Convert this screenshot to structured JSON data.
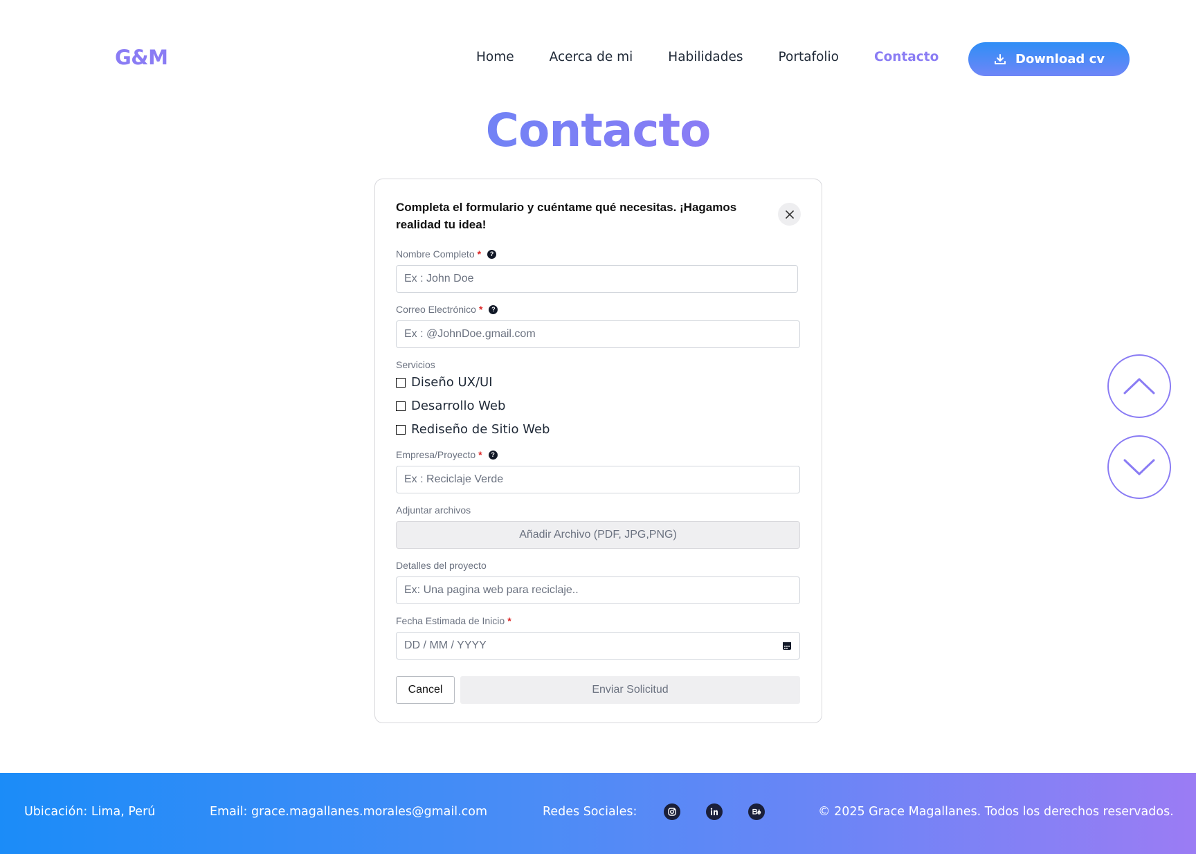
{
  "header": {
    "logo": "G&M",
    "nav": [
      "Home",
      "Acerca de mi",
      "Habilidades",
      "Portafolio",
      "Contacto"
    ],
    "active_nav": "Contacto",
    "download_label": "Download cv"
  },
  "page_title": "Contacto",
  "form": {
    "heading": "Completa el formulario y cuéntame qué necesitas. ¡Hagamos realidad tu idea!",
    "name_label": "Nombre Completo",
    "name_placeholder": "Ex : John Doe",
    "email_label": "Correo Electrónico",
    "email_placeholder": "Ex : @JohnDoe.gmail.com",
    "services_label": "Servicios",
    "services": [
      "Diseño UX/UI",
      "Desarrollo Web",
      "Rediseño de Sitio Web"
    ],
    "company_label": "Empresa/Proyecto",
    "company_placeholder": "Ex : Reciclaje Verde",
    "attach_label": "Adjuntar archivos",
    "attach_button": "Añadir Archivo (PDF, JPG,PNG)",
    "details_label": "Detalles del proyecto",
    "details_placeholder": "Ex: Una pagina web para reciclaje..",
    "date_label": "Fecha Estimada de Inicio",
    "date_placeholder": "DD / MM / YYYY",
    "cancel_label": "Cancel",
    "submit_label": "Enviar Solicitud",
    "required_mark": "*",
    "help_mark": "?"
  },
  "footer": {
    "location": "Ubicación: Lima, Perú",
    "email": "Email: grace.magallanes.morales@gmail.com",
    "social_label": "Redes Sociales:",
    "social_icons": [
      "instagram-icon",
      "linkedin-icon",
      "behance-icon"
    ],
    "copyright": "© 2025 Grace Magallanes. Todos los derechos reservados."
  },
  "colors": {
    "accent": "#8a7cf4",
    "primary_blue": "#2f8ef6",
    "required": "#dc2626"
  }
}
